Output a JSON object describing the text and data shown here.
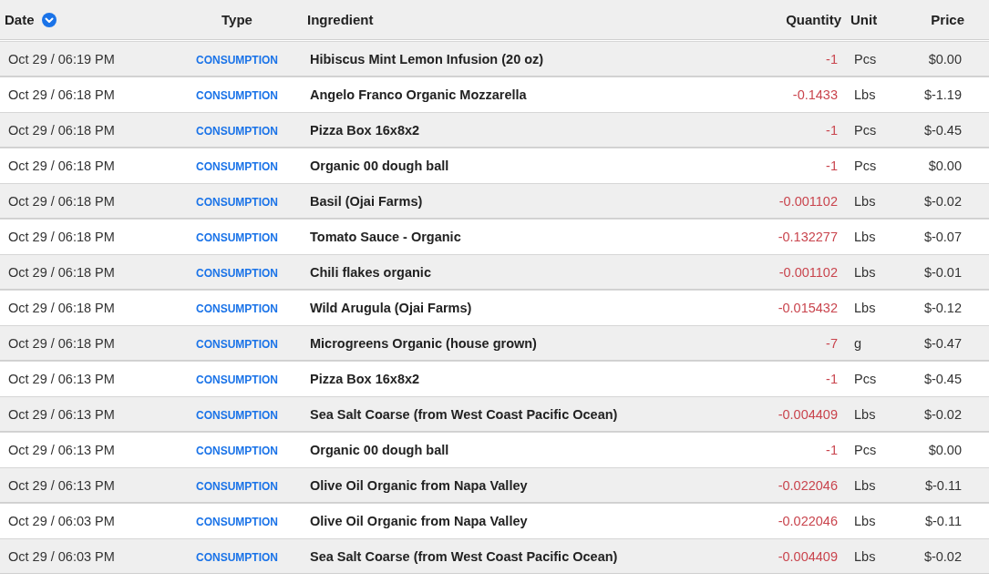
{
  "columns": [
    {
      "label": "Date",
      "sorted": true
    },
    {
      "label": "Type",
      "sorted": false
    },
    {
      "label": "Ingredient",
      "sorted": false
    },
    {
      "label": "Quantity",
      "sorted": false
    },
    {
      "label": "Unit",
      "sorted": false
    },
    {
      "label": "Price",
      "sorted": false
    }
  ],
  "rows": [
    {
      "date": "Oct 29 / 06:19 PM",
      "type": "CONSUMPTION",
      "ingredient": "Hibiscus Mint Lemon Infusion (20 oz)",
      "quantity": "-1",
      "unit": "Pcs",
      "price": "$0.00"
    },
    {
      "date": "Oct 29 / 06:18 PM",
      "type": "CONSUMPTION",
      "ingredient": "Angelo Franco Organic Mozzarella",
      "quantity": "-0.1433",
      "unit": "Lbs",
      "price": "$-1.19"
    },
    {
      "date": "Oct 29 / 06:18 PM",
      "type": "CONSUMPTION",
      "ingredient": "Pizza Box 16x8x2",
      "quantity": "-1",
      "unit": "Pcs",
      "price": "$-0.45"
    },
    {
      "date": "Oct 29 / 06:18 PM",
      "type": "CONSUMPTION",
      "ingredient": "Organic 00 dough ball",
      "quantity": "-1",
      "unit": "Pcs",
      "price": "$0.00"
    },
    {
      "date": "Oct 29 / 06:18 PM",
      "type": "CONSUMPTION",
      "ingredient": "Basil (Ojai Farms)",
      "quantity": "-0.001102",
      "unit": "Lbs",
      "price": "$-0.02"
    },
    {
      "date": "Oct 29 / 06:18 PM",
      "type": "CONSUMPTION",
      "ingredient": "Tomato Sauce - Organic",
      "quantity": "-0.132277",
      "unit": "Lbs",
      "price": "$-0.07"
    },
    {
      "date": "Oct 29 / 06:18 PM",
      "type": "CONSUMPTION",
      "ingredient": "Chili flakes organic",
      "quantity": "-0.001102",
      "unit": "Lbs",
      "price": "$-0.01"
    },
    {
      "date": "Oct 29 / 06:18 PM",
      "type": "CONSUMPTION",
      "ingredient": "Wild Arugula (Ojai Farms)",
      "quantity": "-0.015432",
      "unit": "Lbs",
      "price": "$-0.12"
    },
    {
      "date": "Oct 29 / 06:18 PM",
      "type": "CONSUMPTION",
      "ingredient": "Microgreens Organic (house grown)",
      "quantity": "-7",
      "unit": "g",
      "price": "$-0.47"
    },
    {
      "date": "Oct 29 / 06:13 PM",
      "type": "CONSUMPTION",
      "ingredient": "Pizza Box 16x8x2",
      "quantity": "-1",
      "unit": "Pcs",
      "price": "$-0.45"
    },
    {
      "date": "Oct 29 / 06:13 PM",
      "type": "CONSUMPTION",
      "ingredient": "Sea Salt Coarse (from West Coast Pacific Ocean)",
      "quantity": "-0.004409",
      "unit": "Lbs",
      "price": "$-0.02"
    },
    {
      "date": "Oct 29 / 06:13 PM",
      "type": "CONSUMPTION",
      "ingredient": "Organic 00 dough ball",
      "quantity": "-1",
      "unit": "Pcs",
      "price": "$0.00"
    },
    {
      "date": "Oct 29 / 06:13 PM",
      "type": "CONSUMPTION",
      "ingredient": "Olive Oil Organic from Napa Valley",
      "quantity": "-0.022046",
      "unit": "Lbs",
      "price": "$-0.11"
    },
    {
      "date": "Oct 29 / 06:03 PM",
      "type": "CONSUMPTION",
      "ingredient": "Olive Oil Organic from Napa Valley",
      "quantity": "-0.022046",
      "unit": "Lbs",
      "price": "$-0.11"
    },
    {
      "date": "Oct 29 / 06:03 PM",
      "type": "CONSUMPTION",
      "ingredient": "Sea Salt Coarse (from West Coast Pacific Ocean)",
      "quantity": "-0.004409",
      "unit": "Lbs",
      "price": "$-0.02"
    }
  ]
}
